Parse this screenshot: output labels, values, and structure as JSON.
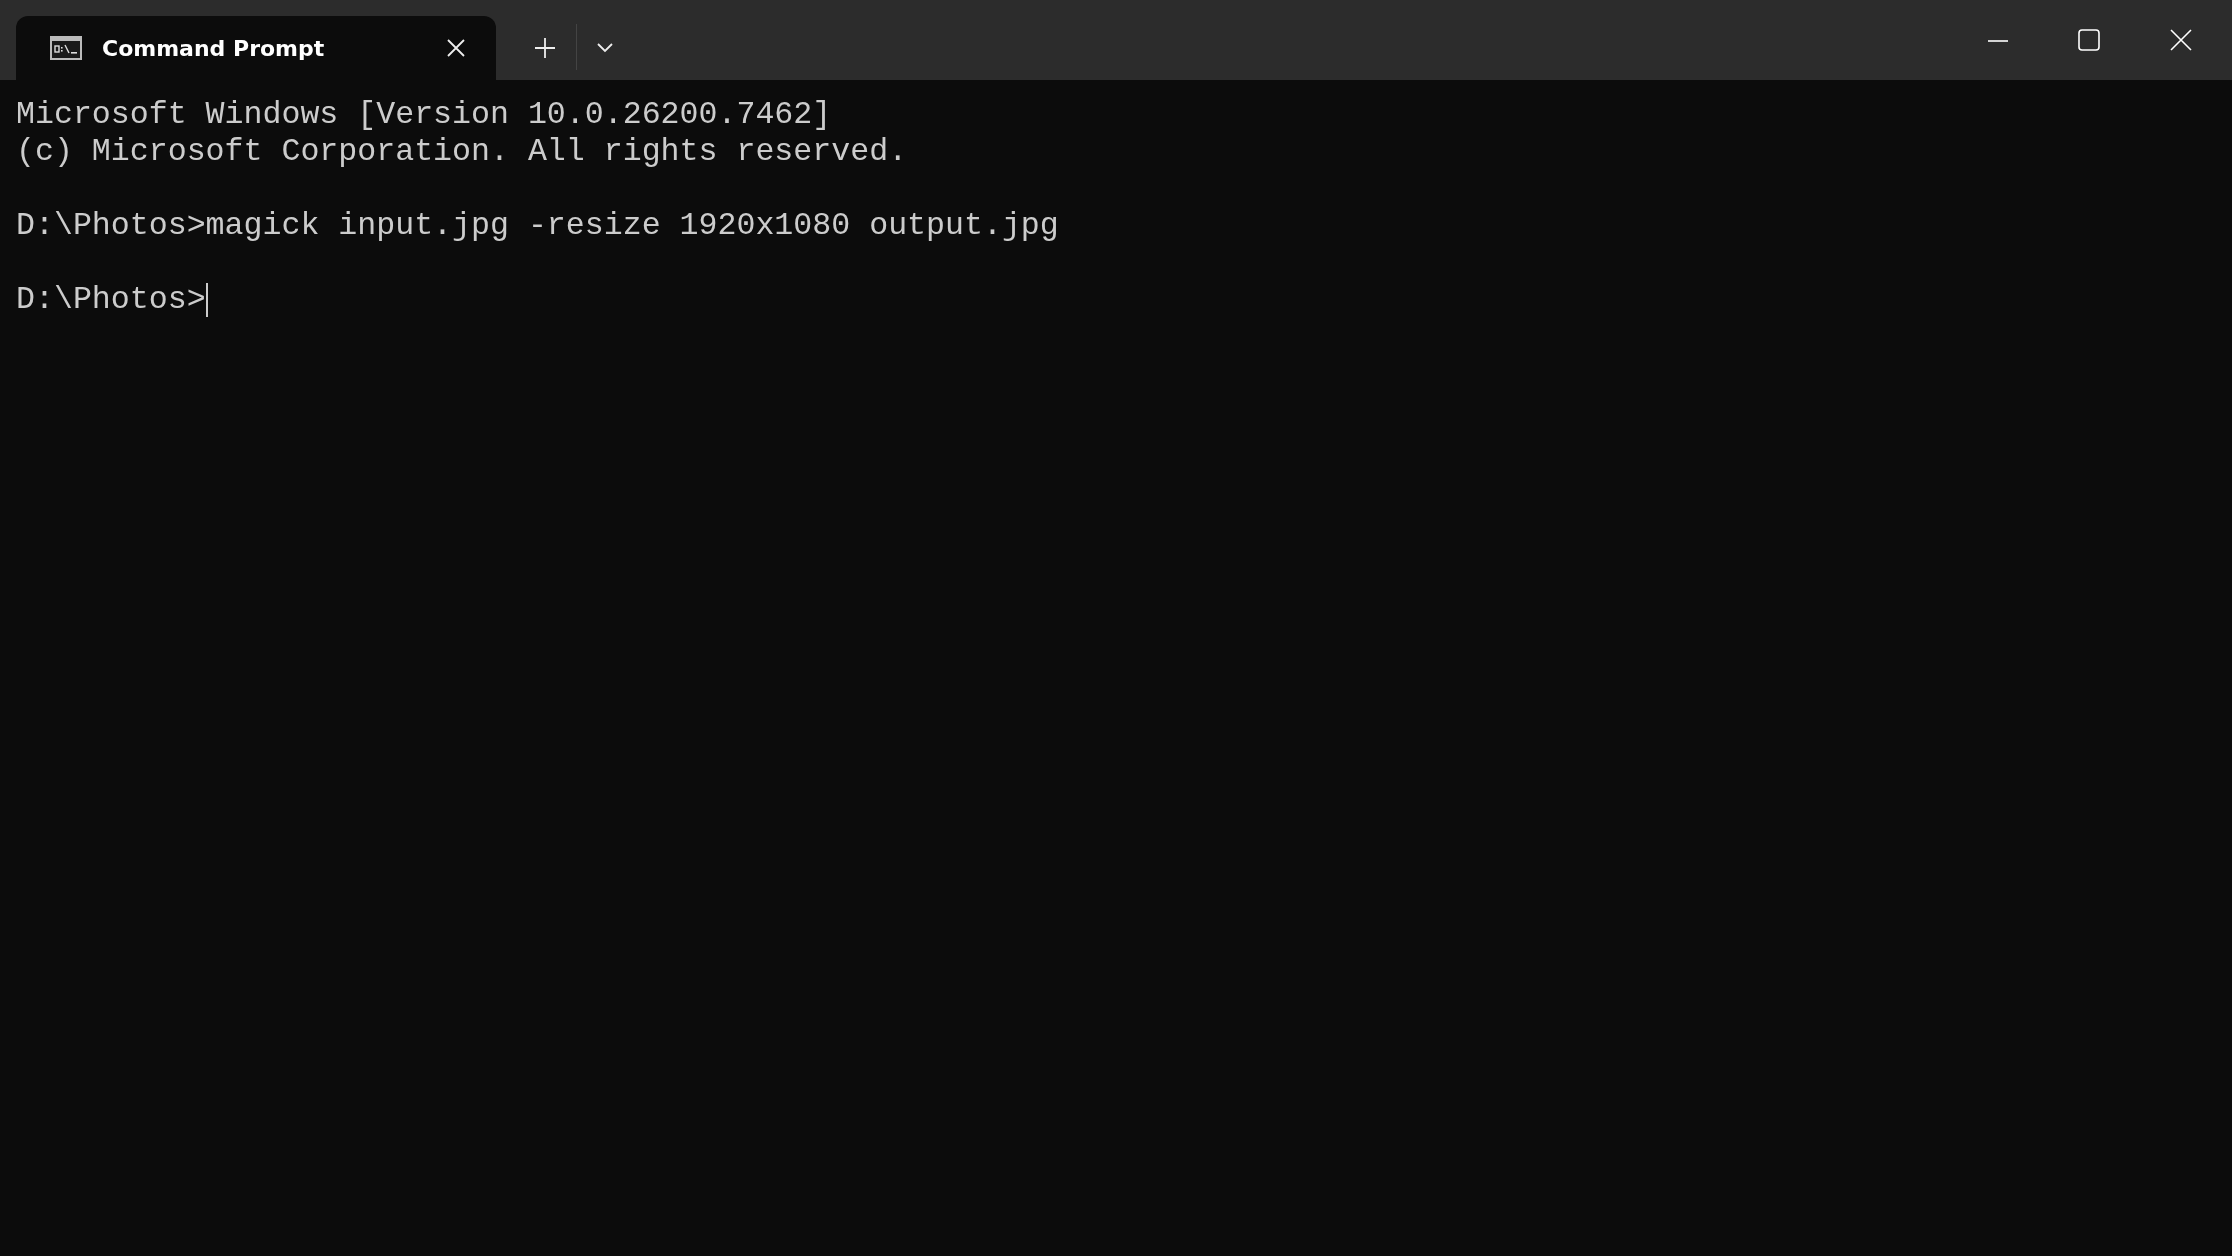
{
  "tabs": [
    {
      "title": "Command Prompt",
      "selected": true
    }
  ],
  "console": {
    "blocks": [
      [
        "Microsoft Windows [Version 10.0.26200.7462]",
        "(c) Microsoft Corporation. All rights reserved."
      ],
      [
        "D:\\Photos>magick input.jpg -resize 1920x1080 output.jpg"
      ],
      [
        "D:\\Photos>"
      ]
    ],
    "cursor": true
  }
}
